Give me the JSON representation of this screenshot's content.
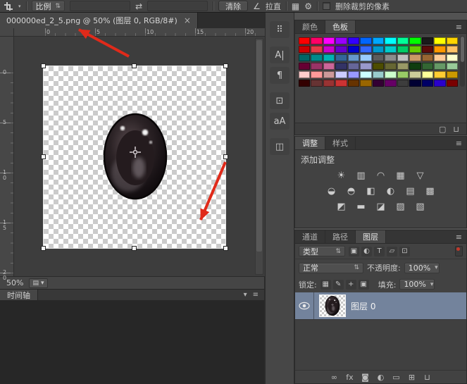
{
  "colors": {
    "accent_red": "#e02a1a",
    "selected_layer_bg": "#73839c",
    "window_bg": "#535353"
  },
  "options_bar": {
    "ratio_dropdown": {
      "label": "比例",
      "arrows": "⇅"
    },
    "width_value": "",
    "swap_icon": "⇄",
    "height_value": "",
    "clear_button": "清除",
    "straighten": {
      "icon": "∠",
      "label": "拉直"
    },
    "overlay_icon": "▦",
    "gear_icon": "⚙",
    "delete_pixels_label": "删除裁剪的像素"
  },
  "document": {
    "tab_title": "000000ed_2_5.png @ 50% (图层 0, RGB/8#)",
    "close_icon": "×",
    "zoom": "50%",
    "status_icon": "▤",
    "status_arrow": "▾"
  },
  "rulers": {
    "h": [
      "0",
      "5",
      "10",
      "15",
      "20"
    ],
    "v": [
      "0",
      "5",
      "10",
      "15",
      "20"
    ]
  },
  "timeline": {
    "title": "时间轴",
    "collapse_icon": "▾",
    "menu_icon": "≡"
  },
  "dock": {
    "groups": [
      [
        {
          "name": "brush-presets-icon",
          "glyph": "⠿"
        }
      ],
      [
        {
          "name": "character-panel-icon",
          "glyph": "A|"
        },
        {
          "name": "paragraph-panel-icon",
          "glyph": "¶"
        }
      ],
      [
        {
          "name": "clone-source-icon",
          "glyph": "⊡"
        },
        {
          "name": "glyphs-panel-icon",
          "glyph": "aA"
        }
      ],
      [
        {
          "name": "3d-panel-icon",
          "glyph": "◫"
        }
      ]
    ]
  },
  "swatches_panel": {
    "tabs": [
      {
        "label": "颜色"
      },
      {
        "label": "色板"
      }
    ],
    "menu_icon": "≡",
    "new_icon": "▢",
    "trash_icon": "⊔",
    "colors": [
      "#ff0000",
      "#ff0066",
      "#ff00ff",
      "#9900ff",
      "#3300ff",
      "#0066ff",
      "#00a8ff",
      "#00ffff",
      "#00ff99",
      "#00ff00",
      "#1a1a1a",
      "#ffff00",
      "#ffd500",
      "#cc0000",
      "#e63946",
      "#cc00cc",
      "#6600cc",
      "#0000cc",
      "#3366ff",
      "#0099cc",
      "#00cccc",
      "#00cc66",
      "#66cc00",
      "#5c0a0a",
      "#ff9900",
      "#ffc266",
      "#006666",
      "#008b8b",
      "#00b3b3",
      "#336699",
      "#6699cc",
      "#99ccff",
      "#5c5c5c",
      "#8c8c8c",
      "#c0c0c0",
      "#cc9966",
      "#996633",
      "#ffcc99",
      "#ffffcc",
      "#660033",
      "#993366",
      "#cc6699",
      "#333366",
      "#666699",
      "#9999cc",
      "#4d4d00",
      "#666633",
      "#999966",
      "#0f3d0f",
      "#336633",
      "#669966",
      "#99cc99",
      "#ffcccc",
      "#ff9999",
      "#cc9999",
      "#ccccff",
      "#9999ff",
      "#ccffff",
      "#99cccc",
      "#ccffcc",
      "#99cc66",
      "#cccc99",
      "#ffff99",
      "#ffcc33",
      "#cc9900",
      "#330000",
      "#663333",
      "#993333",
      "#cc3333",
      "#663300",
      "#996600",
      "#330033",
      "#660066",
      "#3d3d3d",
      "#000033",
      "#000066",
      "#2a00cc",
      "#7a0000"
    ]
  },
  "adjustments_panel": {
    "tabs": [
      {
        "label": "调整"
      },
      {
        "label": "样式"
      }
    ],
    "menu_icon": "≡",
    "title": "添加调整",
    "rows": [
      [
        {
          "name": "brightness-contrast-icon",
          "glyph": "☀"
        },
        {
          "name": "levels-icon",
          "glyph": "▥"
        },
        {
          "name": "curves-icon",
          "glyph": "◠"
        },
        {
          "name": "exposure-icon",
          "glyph": "▦"
        },
        {
          "name": "vibrance-icon",
          "glyph": "▽"
        }
      ],
      [
        {
          "name": "hue-saturation-icon",
          "glyph": "◒"
        },
        {
          "name": "color-balance-icon",
          "glyph": "◓"
        },
        {
          "name": "black-white-icon",
          "glyph": "◧"
        },
        {
          "name": "photo-filter-icon",
          "glyph": "◐"
        },
        {
          "name": "channel-mixer-icon",
          "glyph": "▤"
        },
        {
          "name": "color-lookup-icon",
          "glyph": "▩"
        }
      ],
      [
        {
          "name": "invert-icon",
          "glyph": "◩"
        },
        {
          "name": "posterize-icon",
          "glyph": "▬"
        },
        {
          "name": "threshold-icon",
          "glyph": "◪"
        },
        {
          "name": "gradient-map-icon",
          "glyph": "▨"
        },
        {
          "name": "selective-color-icon",
          "glyph": "▧"
        }
      ]
    ]
  },
  "layers_panel": {
    "tabs": [
      {
        "label": "通道"
      },
      {
        "label": "路径"
      },
      {
        "label": "图层"
      }
    ],
    "menu_icon": "≡",
    "filter": {
      "label": "类型",
      "arrows": "⇅",
      "icons": [
        {
          "name": "filter-pixel-layers-icon",
          "glyph": "▣"
        },
        {
          "name": "filter-adjustment-layers-icon",
          "glyph": "◐"
        },
        {
          "name": "filter-type-layers-icon",
          "glyph": "T"
        },
        {
          "name": "filter-shape-layers-icon",
          "glyph": "▱"
        },
        {
          "name": "filter-smart-objects-icon",
          "glyph": "⊡"
        }
      ]
    },
    "blend": {
      "value": "正常",
      "arrows": "⇅",
      "opacity_label": "不透明度:",
      "opacity_value": "100%",
      "dropdown_arrow": "▾"
    },
    "lock": {
      "label": "锁定:",
      "icons": [
        {
          "name": "lock-transparent-pixels-icon",
          "glyph": "▦"
        },
        {
          "name": "lock-image-pixels-icon",
          "glyph": "✎"
        },
        {
          "name": "lock-position-icon",
          "glyph": "+"
        },
        {
          "name": "lock-all-icon",
          "glyph": "▣"
        }
      ],
      "fill_label": "填充:",
      "fill_value": "100%"
    },
    "layer": {
      "name": "图层 0"
    },
    "bottom_icons": [
      {
        "name": "link-layers-icon",
        "glyph": "∞"
      },
      {
        "name": "layer-style-icon",
        "glyph": "fx"
      },
      {
        "name": "add-layer-mask-icon",
        "glyph": "◙"
      },
      {
        "name": "new-adjustment-layer-icon",
        "glyph": "◐"
      },
      {
        "name": "new-group-icon",
        "glyph": "▭"
      },
      {
        "name": "new-layer-icon",
        "glyph": "⊞"
      },
      {
        "name": "delete-layer-icon",
        "glyph": "⊔"
      }
    ]
  }
}
